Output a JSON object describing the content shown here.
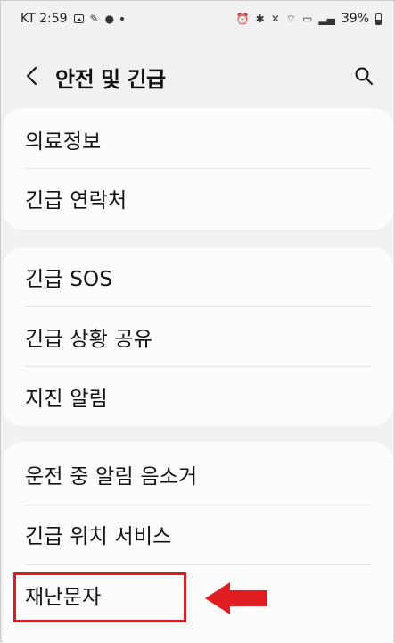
{
  "status_bar": {
    "carrier_time": "KT 2:59",
    "battery_percent": "39%"
  },
  "header": {
    "title": "안전 및 긴급"
  },
  "groups": [
    {
      "items": [
        "의료정보",
        "긴급 연락처"
      ]
    },
    {
      "items": [
        "긴급 SOS",
        "긴급 상황 공유",
        "지진 알림"
      ]
    },
    {
      "items": [
        "운전 중 알림 음소거",
        "긴급 위치 서비스",
        "재난문자"
      ]
    }
  ],
  "annotation": {
    "highlighted_item": "재난문자",
    "color": "#d91e26"
  },
  "colors": {
    "background": "#f1f1f3",
    "card": "#fcfcfc",
    "text": "#111111"
  }
}
